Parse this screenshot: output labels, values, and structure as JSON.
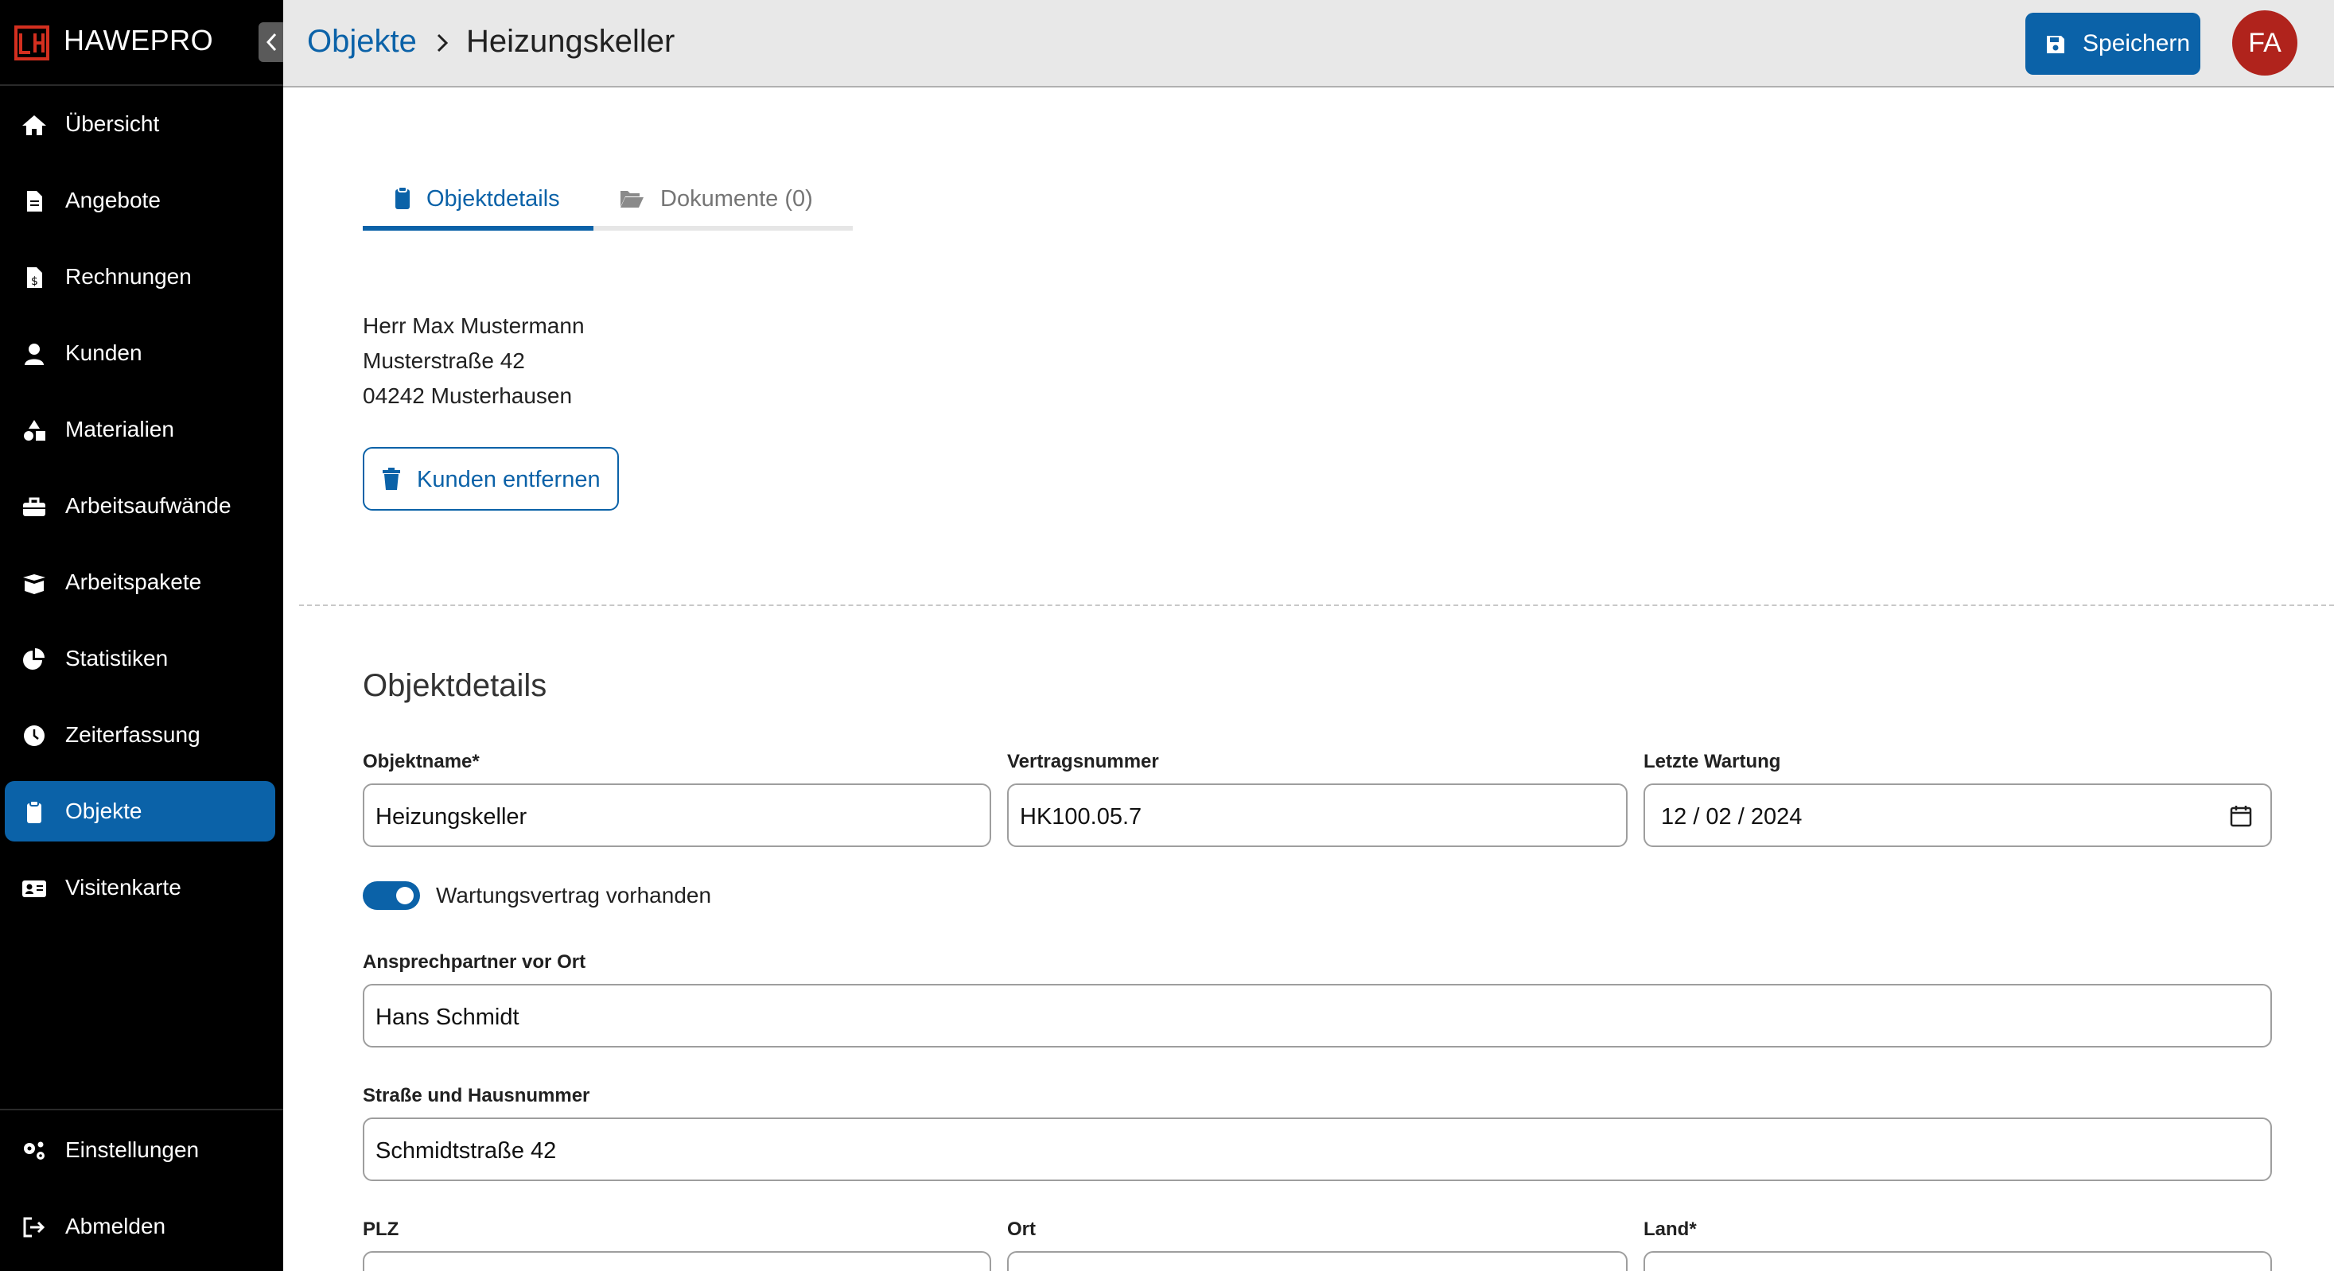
{
  "app": {
    "name": "HAWEPRO"
  },
  "sidebar": {
    "items": [
      {
        "label": "Übersicht",
        "icon": "home-icon"
      },
      {
        "label": "Angebote",
        "icon": "file-icon"
      },
      {
        "label": "Rechnungen",
        "icon": "invoice-icon"
      },
      {
        "label": "Kunden",
        "icon": "user-icon"
      },
      {
        "label": "Materialien",
        "icon": "shapes-icon"
      },
      {
        "label": "Arbeitsaufwände",
        "icon": "toolbox-icon"
      },
      {
        "label": "Arbeitspakete",
        "icon": "box-open-icon"
      },
      {
        "label": "Statistiken",
        "icon": "pie-chart-icon"
      },
      {
        "label": "Zeiterfassung",
        "icon": "clock-icon"
      },
      {
        "label": "Objekte",
        "icon": "clipboard-icon",
        "active": true
      },
      {
        "label": "Visitenkarte",
        "icon": "id-card-icon"
      }
    ],
    "bottom_items": [
      {
        "label": "Einstellungen",
        "icon": "gears-icon"
      },
      {
        "label": "Abmelden",
        "icon": "logout-icon"
      }
    ]
  },
  "header": {
    "breadcrumb_parent": "Objekte",
    "breadcrumb_current": "Heizungskeller",
    "save_label": "Speichern",
    "avatar_initials": "FA"
  },
  "tabs": [
    {
      "label": "Objektdetails",
      "active": true
    },
    {
      "label": "Dokumente (0)",
      "active": false
    }
  ],
  "customer": {
    "name": "Herr Max Mustermann",
    "street": "Musterstraße 42",
    "city": "04242 Musterhausen",
    "remove_label": "Kunden entfernen"
  },
  "form": {
    "section_title": "Objektdetails",
    "object_name_label": "Objektname*",
    "object_name_value": "Heizungskeller",
    "contract_number_label": "Vertragsnummer",
    "contract_number_value": "HK100.05.7",
    "last_maintenance_label": "Letzte Wartung",
    "last_maintenance_value": "12 / 02 / 2024",
    "maintenance_contract_label": "Wartungsvertrag vorhanden",
    "maintenance_contract_on": true,
    "contact_label": "Ansprechpartner vor Ort",
    "contact_value": "Hans Schmidt",
    "street_label": "Straße und Hausnummer",
    "street_value": "Schmidtstraße 42",
    "zip_label": "PLZ",
    "zip_value": "",
    "city_label": "Ort",
    "city_value": "",
    "country_label": "Land*",
    "country_value": ""
  },
  "colors": {
    "primary": "#0b62a8",
    "sidebar_bg": "#000000",
    "header_bg": "#e8e8e8",
    "avatar_bg": "#b0231c",
    "logo_red": "#d32f1f"
  }
}
